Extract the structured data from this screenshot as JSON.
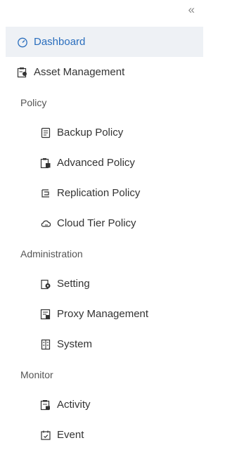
{
  "sidebar": {
    "collapse_glyph": "«",
    "dashboard": "Dashboard",
    "asset_management": "Asset Management",
    "policy_section": "Policy",
    "backup_policy": "Backup Policy",
    "advanced_policy": "Advanced Policy",
    "replication_policy": "Replication Policy",
    "cloud_tier_policy": "Cloud Tier Policy",
    "administration_section": "Administration",
    "setting": "Setting",
    "proxy_management": "Proxy Management",
    "system": "System",
    "monitor_section": "Monitor",
    "activity": "Activity",
    "event": "Event"
  },
  "colors": {
    "active_bg": "#eef1f5",
    "active_text": "#2a6ebd"
  }
}
